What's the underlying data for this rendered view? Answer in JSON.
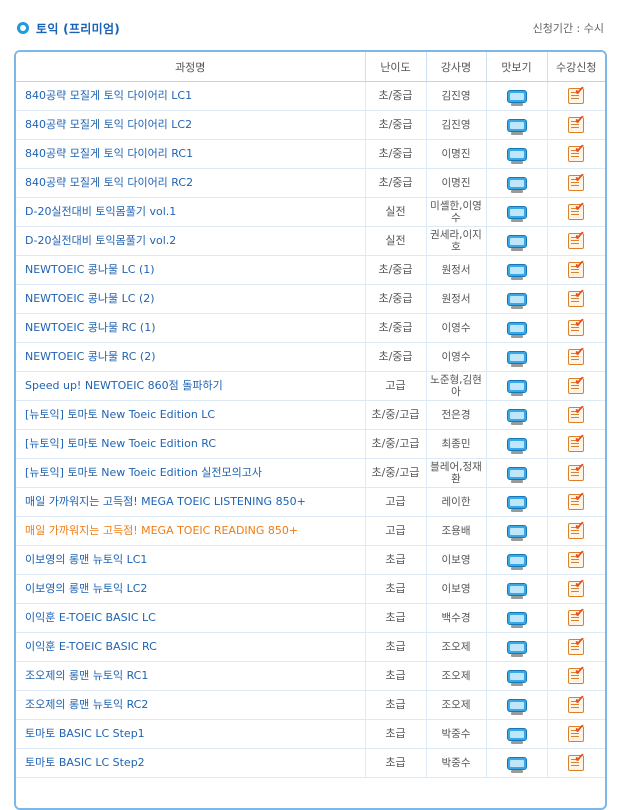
{
  "header": {
    "title": "토익 (프리미엄)",
    "period_label": "신청기간 : 수시"
  },
  "table": {
    "columns": [
      "과정명",
      "난이도",
      "강사명",
      "맛보기",
      "수강신청"
    ],
    "rows": [
      {
        "course": "840공략 모질게 토익 다이어리 LC1",
        "level": "초/중급",
        "teacher": "김진영"
      },
      {
        "course": "840공략 모질게 토익 다이어리 LC2",
        "level": "초/중급",
        "teacher": "김진영"
      },
      {
        "course": "840공략 모질게 토익 다이어리 RC1",
        "level": "초/중급",
        "teacher": "이명진"
      },
      {
        "course": "840공략 모질게 토익 다이어리 RC2",
        "level": "초/중급",
        "teacher": "이명진"
      },
      {
        "course": "D-20실전대비 토익몸풀기 vol.1",
        "level": "실전",
        "teacher": "미셸한,이영수"
      },
      {
        "course": "D-20실전대비 토익몸풀기 vol.2",
        "level": "실전",
        "teacher": "권세라,이지호"
      },
      {
        "course": "NEWTOEIC 콩나물 LC (1)",
        "level": "초/중급",
        "teacher": "원정서"
      },
      {
        "course": "NEWTOEIC 콩나물 LC (2)",
        "level": "초/중급",
        "teacher": "원정서"
      },
      {
        "course": "NEWTOEIC 콩나물 RC (1)",
        "level": "초/중급",
        "teacher": "이영수"
      },
      {
        "course": "NEWTOEIC 콩나물 RC (2)",
        "level": "초/중급",
        "teacher": "이영수"
      },
      {
        "course": "Speed up! NEWTOEIC 860점 돌파하기",
        "level": "고급",
        "teacher": "노준형,김현아"
      },
      {
        "course": "[뉴토익] 토마토 New Toeic Edition LC",
        "level": "초/중/고급",
        "teacher": "전은경"
      },
      {
        "course": "[뉴토익] 토마토 New Toeic Edition RC",
        "level": "초/중/고급",
        "teacher": "최종민"
      },
      {
        "course": "[뉴토익] 토마토 New Toeic Edition 실전모의고사",
        "level": "초/중/고급",
        "teacher": "블레어,정재환"
      },
      {
        "course": "매일 가까워지는 고득점! MEGA TOEIC LISTENING 850+",
        "level": "고급",
        "teacher": "레이한"
      },
      {
        "course": "매일 가까워지는 고득점! MEGA TOEIC READING 850+",
        "level": "고급",
        "teacher": "조용배",
        "highlight": true
      },
      {
        "course": "이보영의 롱맨 뉴토익 LC1",
        "level": "초급",
        "teacher": "이보영"
      },
      {
        "course": "이보영의 롱맨 뉴토익 LC2",
        "level": "초급",
        "teacher": "이보영"
      },
      {
        "course": "이익훈 E-TOEIC BASIC LC",
        "level": "초급",
        "teacher": "백수경"
      },
      {
        "course": "이익훈 E-TOEIC BASIC RC",
        "level": "초급",
        "teacher": "조오제"
      },
      {
        "course": "조오제의 롱맨 뉴토익 RC1",
        "level": "초급",
        "teacher": "조오제"
      },
      {
        "course": "조오제의 롱맨 뉴토익 RC2",
        "level": "초급",
        "teacher": "조오제"
      },
      {
        "course": "토마토 BASIC LC Step1",
        "level": "초급",
        "teacher": "박중수"
      },
      {
        "course": "토마토 BASIC LC Step2",
        "level": "초급",
        "teacher": "박중수"
      }
    ]
  },
  "icons": {
    "preview": "tv-icon",
    "apply": "checklist-icon"
  }
}
